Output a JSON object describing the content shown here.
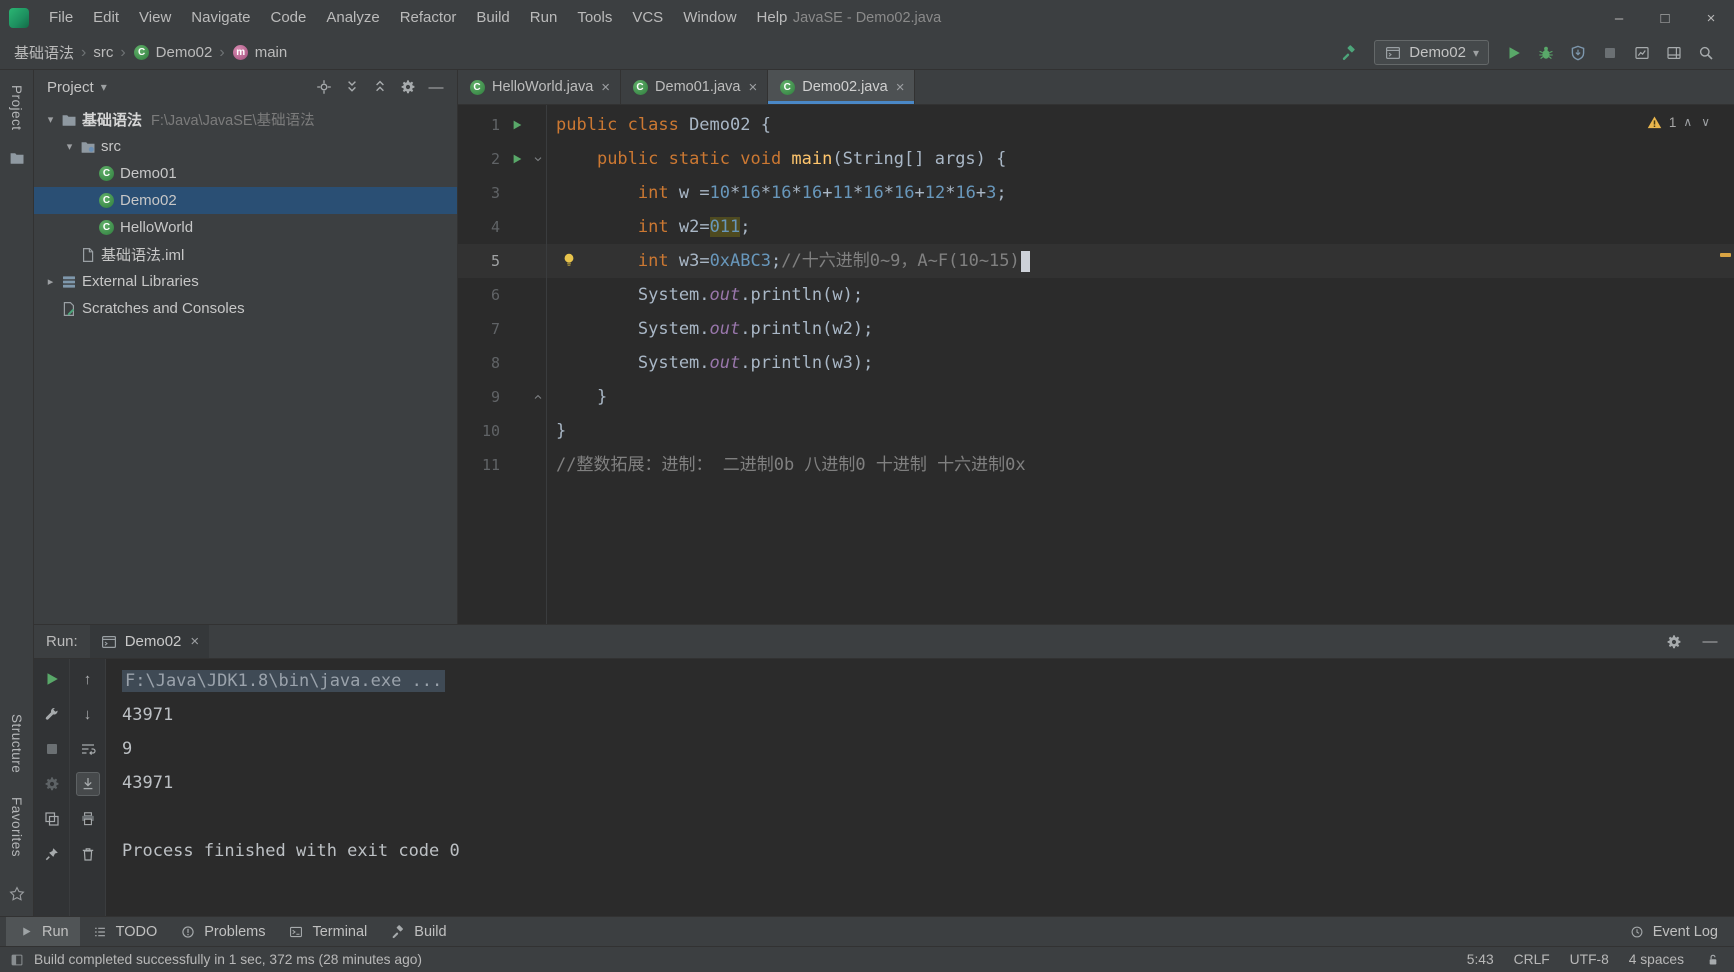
{
  "titlebar": {
    "title": "JavaSE - Demo02.java",
    "menus": [
      "File",
      "Edit",
      "View",
      "Navigate",
      "Code",
      "Analyze",
      "Refactor",
      "Build",
      "Run",
      "Tools",
      "VCS",
      "Window",
      "Help"
    ],
    "window_controls": {
      "minimize": "–",
      "maximize": "□",
      "close": "×"
    }
  },
  "navbar": {
    "breadcrumbs": [
      {
        "label": "基础语法",
        "icon": ""
      },
      {
        "label": "src",
        "icon": ""
      },
      {
        "label": "Demo02",
        "icon": "class"
      },
      {
        "label": "main",
        "icon": "method"
      }
    ],
    "left_actions": [
      {
        "name": "build-project-button",
        "icon": "hammer"
      }
    ],
    "run_config": {
      "label": "Demo02",
      "caret": "▾"
    },
    "right_actions": [
      {
        "name": "run-button",
        "icon": "play"
      },
      {
        "name": "debug-button",
        "icon": "bug"
      },
      {
        "name": "coverage-button",
        "icon": "coverage"
      },
      {
        "name": "stop-button",
        "icon": "stop"
      },
      {
        "name": "profiler-button",
        "icon": "profiler"
      },
      {
        "name": "hide-windows-button",
        "icon": "layout"
      },
      {
        "name": "search-everywhere-button",
        "icon": "search"
      }
    ]
  },
  "stripe": {
    "project": "Project",
    "structure": "Structure",
    "favorites": "Favorites"
  },
  "project": {
    "title": "Project",
    "caret": "▾",
    "header_actions": [
      {
        "name": "locate-file-button",
        "icon": "locate"
      },
      {
        "name": "expand-all-button",
        "icon": "expand-all"
      },
      {
        "name": "collapse-all-button",
        "icon": "collapse-all"
      },
      {
        "name": "settings-button",
        "icon": "gear"
      },
      {
        "name": "hide-panel-button",
        "icon": "minus"
      }
    ],
    "tree": [
      {
        "level": 0,
        "chevron": "down",
        "icon": "folder",
        "label": "基础语法",
        "hint": "F:\\Java\\JavaSE\\基础语法",
        "bold": true
      },
      {
        "level": 1,
        "chevron": "down",
        "icon": "folder-src",
        "label": "src"
      },
      {
        "level": 2,
        "chevron": "",
        "icon": "class",
        "label": "Demo01"
      },
      {
        "level": 2,
        "chevron": "",
        "icon": "class",
        "label": "Demo02",
        "selected": true
      },
      {
        "level": 2,
        "chevron": "",
        "icon": "class",
        "label": "HelloWorld"
      },
      {
        "level": 1,
        "chevron": "",
        "icon": "file",
        "label": "基础语法.iml"
      },
      {
        "level": 0,
        "chevron": "right",
        "icon": "libraries",
        "label": "External Libraries"
      },
      {
        "level": 0,
        "chevron": "",
        "icon": "scratches",
        "label": "Scratches and Consoles"
      }
    ]
  },
  "editor": {
    "tab_close": "×",
    "tabs": [
      {
        "label": "HelloWorld.java",
        "active": false
      },
      {
        "label": "Demo01.java",
        "active": false
      },
      {
        "label": "Demo02.java",
        "active": true
      }
    ],
    "inspection": {
      "count": "1",
      "up": "∧",
      "down": "∨"
    },
    "lines": [
      {
        "num": "1",
        "run": true,
        "tokens": [
          [
            "kw",
            "public class "
          ],
          [
            "plain",
            "Demo02 {"
          ]
        ]
      },
      {
        "num": "2",
        "run": true,
        "fold": "down",
        "tokens": [
          [
            "plain",
            "    "
          ],
          [
            "kw",
            "public static void "
          ],
          [
            "method",
            "main"
          ],
          [
            "plain",
            "(String[] args) {"
          ]
        ]
      },
      {
        "num": "3",
        "tokens": [
          [
            "plain",
            "        "
          ],
          [
            "kw",
            "int"
          ],
          [
            "plain",
            " w ="
          ],
          [
            "num",
            "10"
          ],
          [
            "plain",
            "*"
          ],
          [
            "num",
            "16"
          ],
          [
            "plain",
            "*"
          ],
          [
            "num",
            "16"
          ],
          [
            "plain",
            "*"
          ],
          [
            "num",
            "16"
          ],
          [
            "plain",
            "+"
          ],
          [
            "num",
            "11"
          ],
          [
            "plain",
            "*"
          ],
          [
            "num",
            "16"
          ],
          [
            "plain",
            "*"
          ],
          [
            "num",
            "16"
          ],
          [
            "plain",
            "+"
          ],
          [
            "num",
            "12"
          ],
          [
            "plain",
            "*"
          ],
          [
            "num",
            "16"
          ],
          [
            "plain",
            "+"
          ],
          [
            "num",
            "3"
          ],
          [
            "plain",
            ";"
          ]
        ]
      },
      {
        "num": "4",
        "tokens": [
          [
            "plain",
            "        "
          ],
          [
            "kw",
            "int"
          ],
          [
            "plain",
            " w2="
          ],
          [
            "numhl",
            "011"
          ],
          [
            "plain",
            ";"
          ]
        ]
      },
      {
        "num": "5",
        "current": true,
        "bulb": true,
        "caret": true,
        "tokens": [
          [
            "plain",
            "        "
          ],
          [
            "kw",
            "int"
          ],
          [
            "plain",
            " w3="
          ],
          [
            "num",
            "0xABC3"
          ],
          [
            "plain",
            ";"
          ],
          [
            "comment",
            "//十六进制0~9，A~F(10~15)"
          ]
        ]
      },
      {
        "num": "6",
        "tokens": [
          [
            "plain",
            "        System."
          ],
          [
            "field",
            "out"
          ],
          [
            "plain",
            ".println(w);"
          ]
        ]
      },
      {
        "num": "7",
        "tokens": [
          [
            "plain",
            "        System."
          ],
          [
            "field",
            "out"
          ],
          [
            "plain",
            ".println(w2);"
          ]
        ]
      },
      {
        "num": "8",
        "tokens": [
          [
            "plain",
            "        System."
          ],
          [
            "field",
            "out"
          ],
          [
            "plain",
            ".println(w3);"
          ]
        ]
      },
      {
        "num": "9",
        "fold": "up",
        "tokens": [
          [
            "plain",
            "    }"
          ]
        ]
      },
      {
        "num": "10",
        "tokens": [
          [
            "plain",
            "}"
          ]
        ]
      },
      {
        "num": "11",
        "tokens": [
          [
            "comment",
            "//整数拓展：进制： 二进制0b 八进制0 十进制 十六进制0x"
          ]
        ]
      }
    ]
  },
  "run_panel": {
    "label": "Run:",
    "tab": {
      "label": "Demo02",
      "close": "×"
    },
    "header_actions": [
      {
        "name": "console-settings-button",
        "icon": "gear"
      },
      {
        "name": "hide-run-panel-button",
        "icon": "minus"
      }
    ],
    "outer_toolbar": [
      {
        "name": "rerun-button",
        "icon": "play"
      },
      {
        "name": "modify-run-configuration-button",
        "icon": "wrench"
      },
      {
        "name": "stop-process-button",
        "icon": "stop"
      },
      {
        "name": "console-gear-button",
        "icon": "gear-dim"
      },
      {
        "name": "restore-layout-button",
        "icon": "restore-layout"
      },
      {
        "name": "pin-tab-button",
        "icon": "pin"
      }
    ],
    "inner_toolbar": [
      {
        "name": "up-stack-trace-button",
        "icon": "arrow-up"
      },
      {
        "name": "down-stack-trace-button",
        "icon": "arrow-down"
      },
      {
        "name": "soft-wrap-button",
        "icon": "soft-wrap"
      },
      {
        "name": "scroll-to-end-button",
        "icon": "scroll-end",
        "selected": true
      },
      {
        "name": "print-button",
        "icon": "printer"
      },
      {
        "name": "clear-all-button",
        "icon": "trash"
      }
    ],
    "console_lines": [
      {
        "style": "cmd",
        "text": "F:\\Java\\JDK1.8\\bin\\java.exe ..."
      },
      {
        "style": "out",
        "text": "43971"
      },
      {
        "style": "out",
        "text": "9"
      },
      {
        "style": "out",
        "text": "43971"
      },
      {
        "style": "out",
        "text": ""
      },
      {
        "style": "out",
        "text": "Process finished with exit code 0"
      }
    ]
  },
  "bottombar": {
    "items": [
      {
        "label": "Run",
        "icon": "play-small",
        "active": true
      },
      {
        "label": "TODO",
        "icon": "todo",
        "active": false
      },
      {
        "label": "Problems",
        "icon": "problems",
        "active": false
      },
      {
        "label": "Terminal",
        "icon": "terminal",
        "active": false
      },
      {
        "label": "Build",
        "icon": "hammer-gray",
        "active": false
      }
    ],
    "event_log": "Event Log"
  },
  "statusbar": {
    "message": "Build completed successfully in 1 sec, 372 ms (28 minutes ago)",
    "cursor_position": "5:43",
    "line_ending": "CRLF",
    "encoding": "UTF-8",
    "indent": "4 spaces"
  }
}
